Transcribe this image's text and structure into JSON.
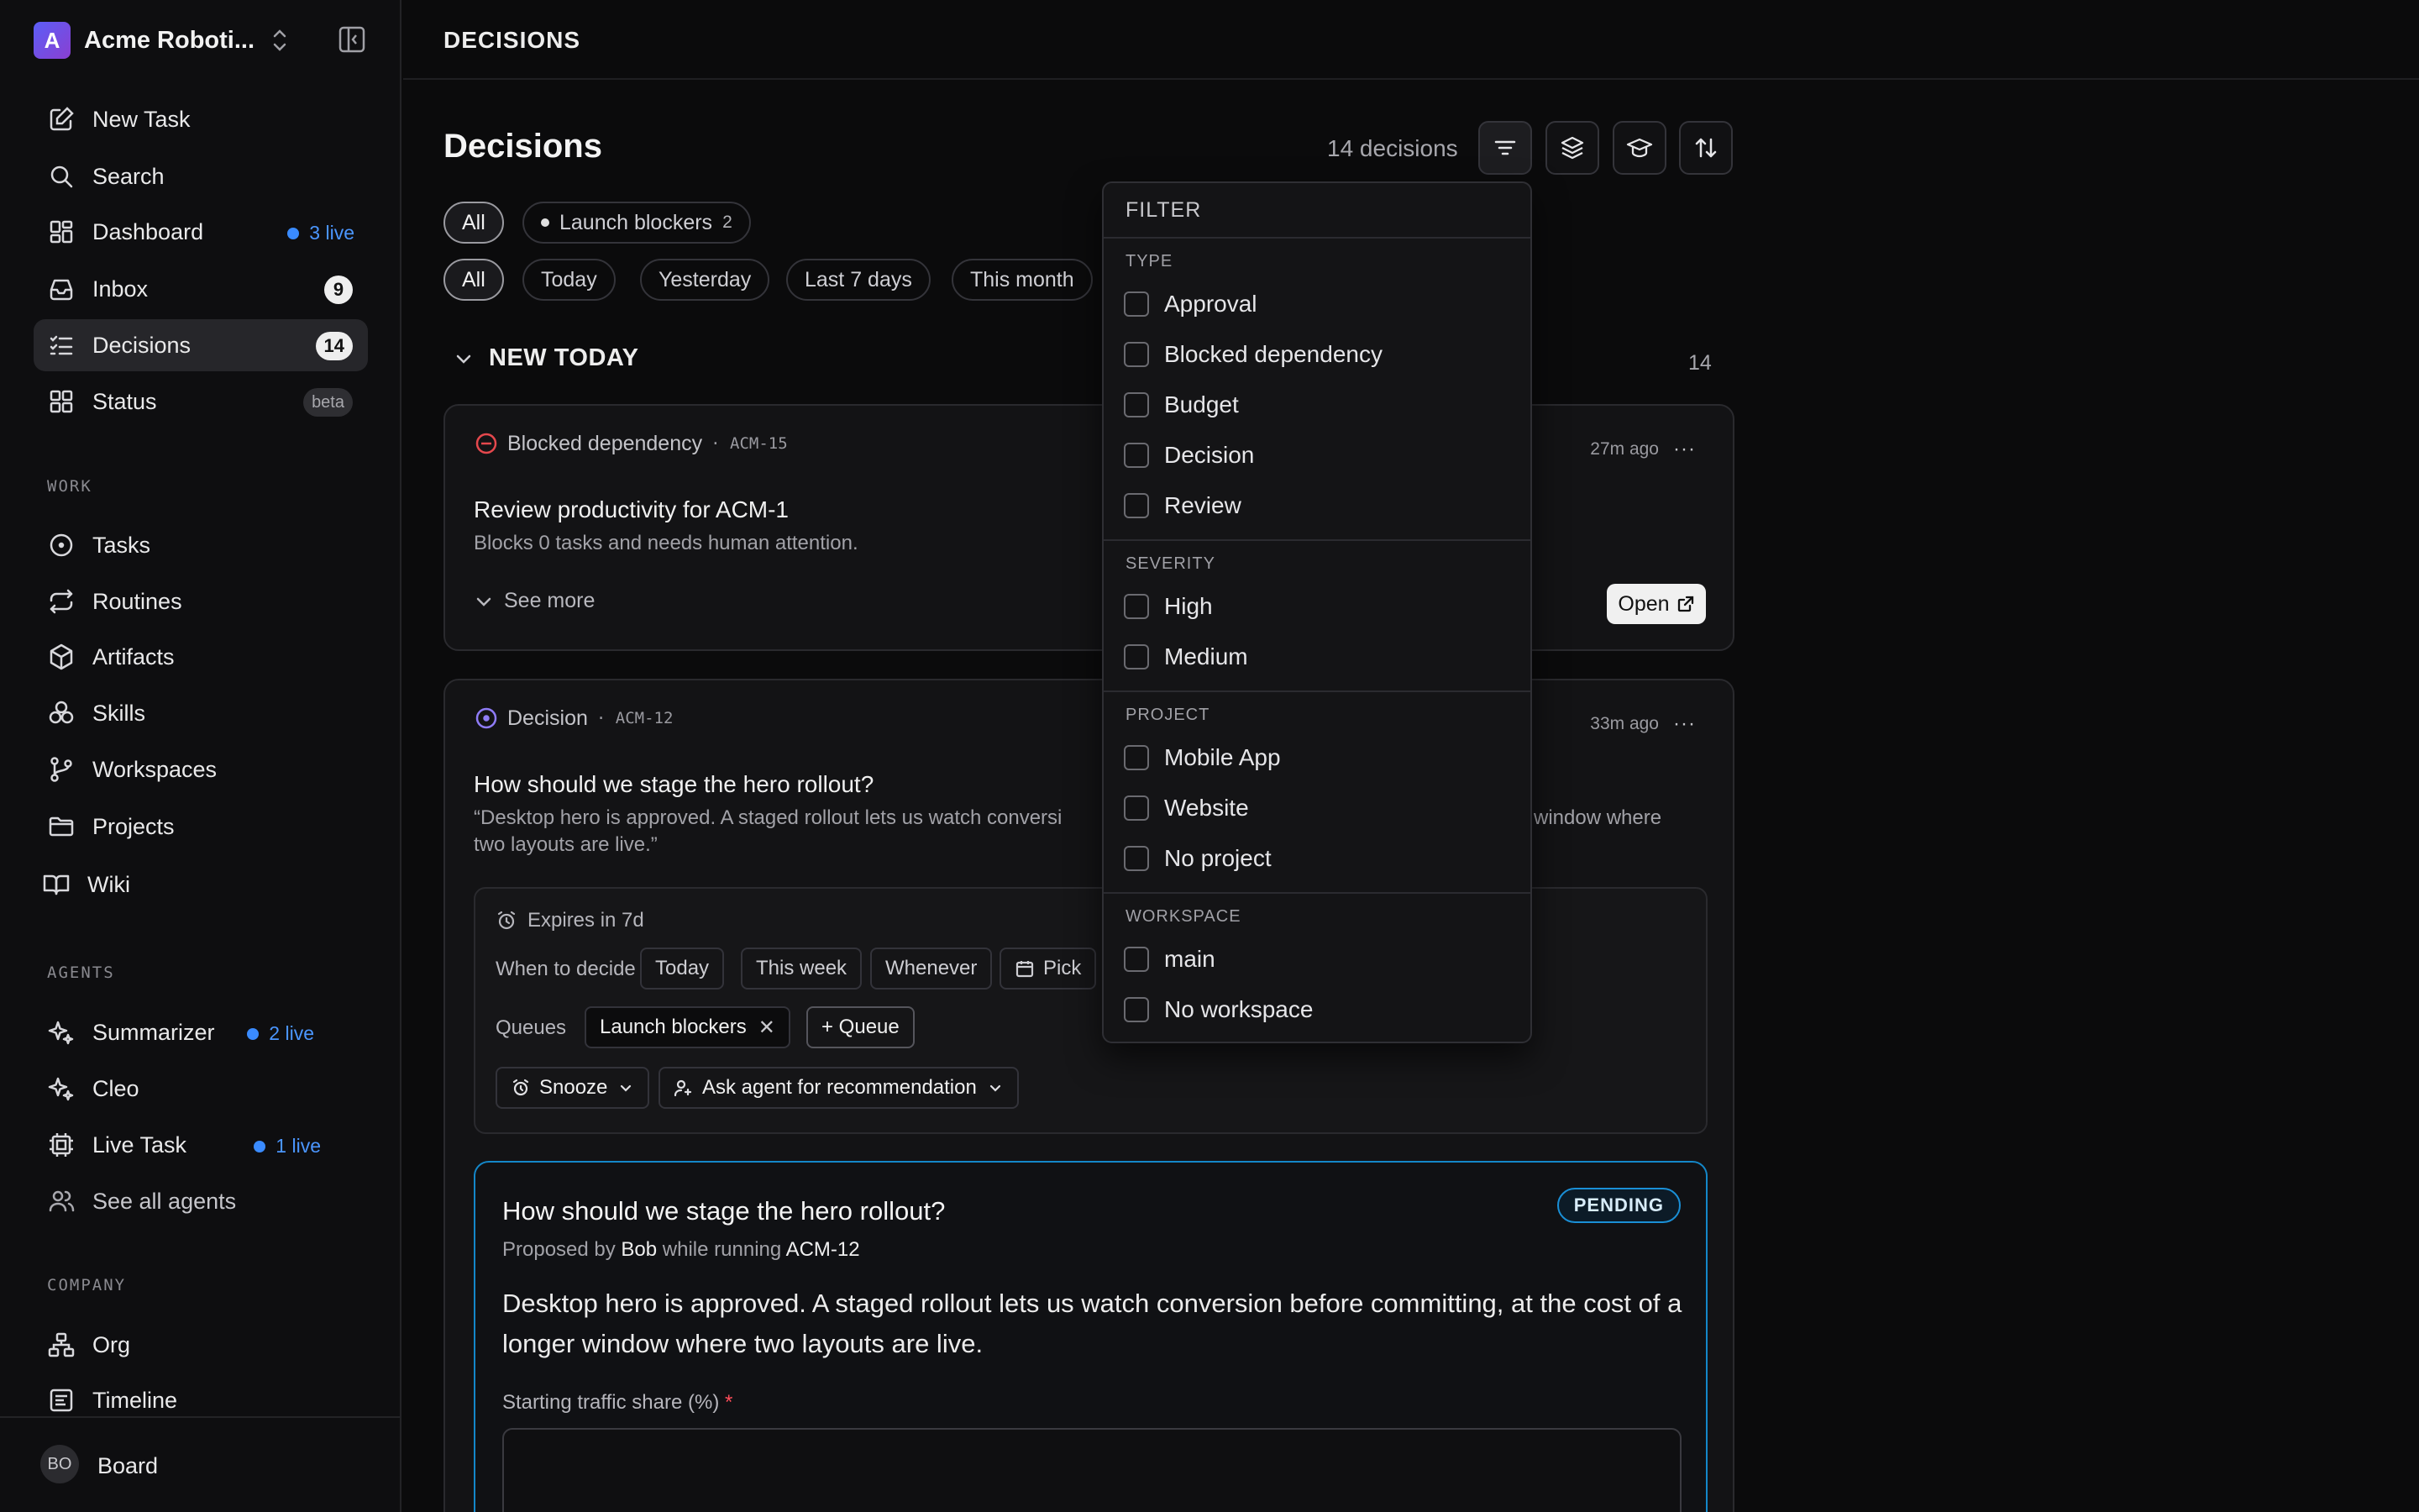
{
  "workspace": {
    "name": "Acme Roboti...",
    "logo_letter": "A"
  },
  "nav": {
    "new_task": "New Task",
    "search": "Search",
    "dashboard": "Dashboard",
    "dashboard_live": "3 live",
    "inbox": "Inbox",
    "inbox_count": "9",
    "decisions": "Decisions",
    "decisions_count": "14",
    "status": "Status",
    "status_badge": "beta"
  },
  "sections": {
    "work": "WORK",
    "agents": "AGENTS",
    "company": "COMPANY"
  },
  "work_items": {
    "tasks": "Tasks",
    "routines": "Routines",
    "artifacts": "Artifacts",
    "skills": "Skills",
    "workspaces": "Workspaces",
    "projects": "Projects",
    "wiki": "Wiki"
  },
  "agents": {
    "summarizer": "Summarizer",
    "summarizer_live": "2 live",
    "cleo": "Cleo",
    "live_task": "Live Task",
    "live_task_live": "1 live",
    "see_all": "See all agents"
  },
  "company": {
    "org": "Org",
    "timeline": "Timeline"
  },
  "footer": {
    "avatar": "BO",
    "label": "Board"
  },
  "header": {
    "breadcrumb": "DECISIONS",
    "title": "Decisions",
    "count": "14 decisions"
  },
  "queue_chips": {
    "all": "All",
    "launch_blockers": "Launch blockers",
    "launch_blockers_count": "2"
  },
  "time_chips": {
    "all": "All",
    "today": "Today",
    "yesterday": "Yesterday",
    "last7": "Last 7 days",
    "this_month": "This month"
  },
  "group": {
    "title": "NEW TODAY",
    "count": "14"
  },
  "card1": {
    "type": "Blocked dependency",
    "key": "· ACM-15",
    "time": "27m ago",
    "more": "···",
    "title": "Review productivity for ACM-1",
    "subtitle": "Blocks 0 tasks and needs human attention.",
    "see_more": "See more",
    "open": "Open"
  },
  "card2": {
    "type": "Decision",
    "key": "· ACM-12",
    "time": "33m ago",
    "more": "···",
    "title": "How should we stage the hero rollout?",
    "quote_a": "“Desktop hero is approved. A staged rollout lets us watch conversi",
    "quote_b": "window where",
    "quote_c": "two layouts are live.”",
    "expires": "Expires in 7d",
    "when_label": "When to decide",
    "when_today": "Today",
    "when_week": "This week",
    "when_whenever": "Whenever",
    "when_pick": "Pick",
    "queues_label": "Queues",
    "queue_tag": "Launch blockers",
    "queue_add": "+ Queue",
    "snooze": "Snooze",
    "ask_agent": "Ask agent for recommendation",
    "box": {
      "title": "How should we stage the hero rollout?",
      "status": "PENDING",
      "proposed_prefix": "Proposed by ",
      "proposed_by": "Bob",
      "proposed_mid": " while running ",
      "proposed_task": "ACM-12",
      "body": "Desktop hero is approved. A staged rollout lets us watch conversion before committing, at the cost of a longer window where two layouts are live.",
      "field_label": "Starting traffic share (%)",
      "required_mark": "*"
    }
  },
  "filter": {
    "title": "FILTER",
    "type_label": "TYPE",
    "types": [
      "Approval",
      "Blocked dependency",
      "Budget",
      "Decision",
      "Review"
    ],
    "severity_label": "SEVERITY",
    "severities": [
      "High",
      "Medium"
    ],
    "project_label": "PROJECT",
    "projects": [
      "Mobile App",
      "Website",
      "No project"
    ],
    "workspace_label": "WORKSPACE",
    "workspaces": [
      "main",
      "No workspace"
    ]
  },
  "colors": {
    "accent": "#3a8bff",
    "pending_border": "#1a8fd6",
    "required": "#ff4d5a",
    "blocked_icon": "#e5484d",
    "decision_icon": "#8f7cf7"
  }
}
